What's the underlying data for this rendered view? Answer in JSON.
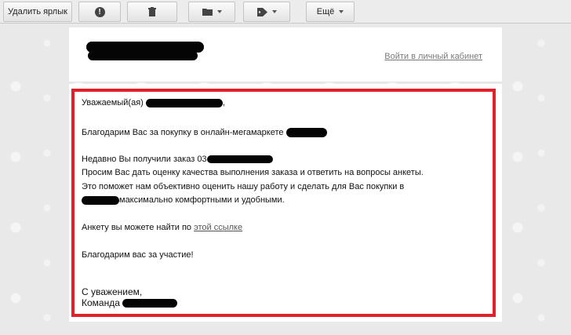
{
  "toolbar": {
    "delete_label_button": "Удалить ярлык",
    "more_button": "Ещё",
    "icons": [
      "exclamation-icon",
      "trash-icon",
      "folder-icon",
      "tag-icon"
    ]
  },
  "header": {
    "account_link": "Войти в личный кабинет"
  },
  "message": {
    "greeting": "Уважаемый(ая)",
    "greeting_tail": ",",
    "thanks_purchase": "Благодарим Вас за покупку в онлайн-мегамаркете",
    "order_received": "Недавно Вы получили заказ",
    "order_number_visible": "03",
    "rate_request": "Просим Вас дать оценку качества выполнения заказа и ответить на вопросы анкеты.",
    "help_line1": "Это поможет нам объективно оценить нашу работу и сделать для Вас покупки в",
    "help_line2": "максимально комфортными и удобными.",
    "survey_prefix": "Анкету вы можете найти по",
    "survey_link": "этой ссылке",
    "thanks_participation": "Благодарим вас за участие!",
    "regards": "С уважением,",
    "team": "Команда"
  },
  "colors": {
    "highlight_frame": "#e0202a",
    "link": "#7a7a7a",
    "redaction": "#050505"
  }
}
